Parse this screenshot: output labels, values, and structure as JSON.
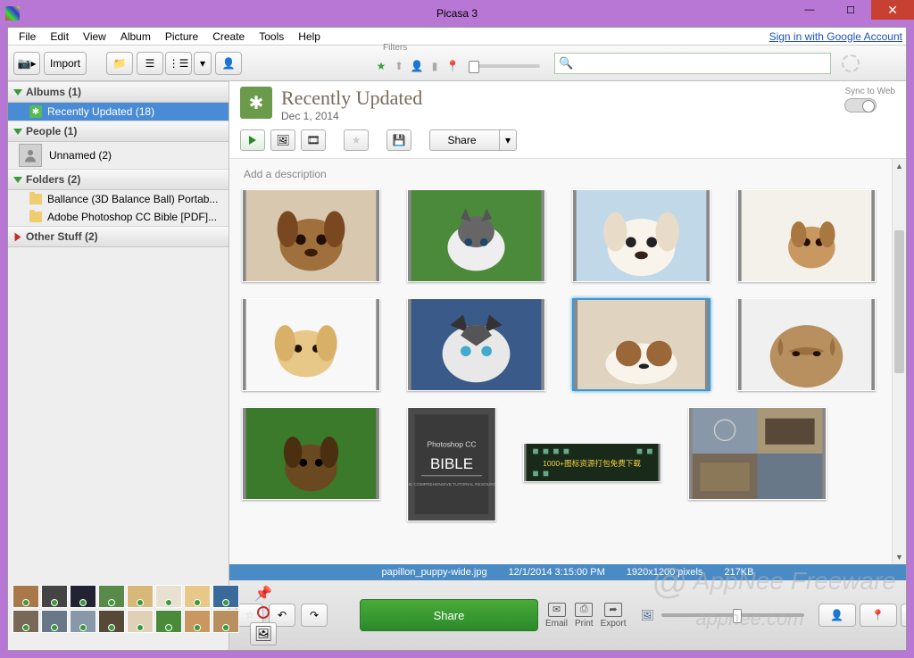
{
  "window": {
    "title": "Picasa 3",
    "signin": "Sign in with Google Account"
  },
  "menu": [
    "File",
    "Edit",
    "View",
    "Album",
    "Picture",
    "Create",
    "Tools",
    "Help"
  ],
  "toolbar": {
    "import": "Import",
    "filters_label": "Filters"
  },
  "sidebar": {
    "albums": {
      "header": "Albums (1)",
      "items": [
        {
          "label": "Recently Updated (18)",
          "selected": true
        }
      ]
    },
    "people": {
      "header": "People (1)",
      "items": [
        {
          "label": "Unnamed (2)"
        }
      ]
    },
    "folders": {
      "header": "Folders (2)",
      "items": [
        {
          "label": "Ballance (3D Balance Ball) Portab..."
        },
        {
          "label": "Adobe Photoshop CC Bible [PDF]..."
        }
      ]
    },
    "other": {
      "header": "Other Stuff (2)"
    }
  },
  "content": {
    "title": "Recently Updated",
    "date": "Dec 1, 2014",
    "sync_label": "Sync to Web",
    "share_btn": "Share",
    "description_placeholder": "Add a description"
  },
  "status": {
    "filename": "papillon_puppy-wide.jpg",
    "datetime": "12/1/2014 3:15:00 PM",
    "dimensions": "1920x1200 pixels",
    "filesize": "217KB"
  },
  "tray": {
    "share": "Share",
    "actions": [
      {
        "label": "Email",
        "icon": "✉"
      },
      {
        "label": "Print",
        "icon": "⎙"
      },
      {
        "label": "Export",
        "icon": "➦"
      }
    ]
  },
  "thumbnails": [
    {
      "type": "puppy-brown"
    },
    {
      "type": "husky-grass"
    },
    {
      "type": "puppy-white"
    },
    {
      "type": "puppy-tan-floor"
    },
    {
      "type": "golden-pup"
    },
    {
      "type": "husky-blue"
    },
    {
      "type": "papillon",
      "selected": true
    },
    {
      "type": "sharpei"
    },
    {
      "type": "puppy-grass"
    },
    {
      "type": "book-tall"
    },
    {
      "type": "banner-short"
    },
    {
      "type": "game-shot"
    }
  ],
  "watermark": "AppNee Freeware appnee.com"
}
